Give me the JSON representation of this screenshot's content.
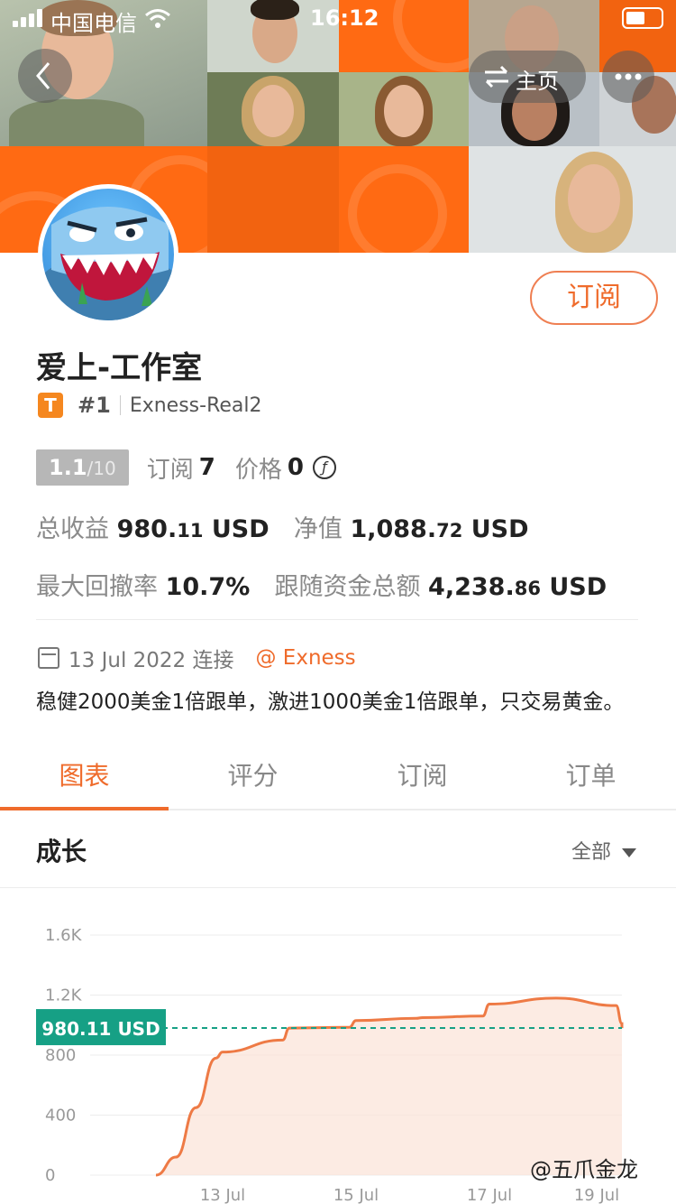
{
  "status_bar": {
    "carrier": "中国电信",
    "time": "16:12"
  },
  "nav": {
    "home_label": "主页"
  },
  "profile": {
    "subscribe_label": "订阅",
    "name": "爱上-工作室",
    "badge": "T",
    "rank": "#1",
    "account": "Exness-Real2",
    "score": "1.1",
    "score_max": "/10",
    "subs_label": "订阅",
    "subs_value": "7",
    "price_label": "价格",
    "price_value": "0",
    "coin_glyph": "ƒ",
    "total_profit_label": "总收益",
    "total_profit_int": "980.",
    "total_profit_dec": "11",
    "total_profit_unit": "USD",
    "equity_label": "净值",
    "equity_int": "1,088.",
    "equity_dec": "72",
    "equity_unit": "USD",
    "drawdown_label": "最大回撤率",
    "drawdown_value": "10.7%",
    "follow_label": "跟随资金总额",
    "follow_int": "4,238.",
    "follow_dec": "86",
    "follow_unit": "USD",
    "date": "13 Jul 2022 连接",
    "broker": "@ Exness",
    "description": "稳健2000美金1倍跟单，激进1000美金1倍跟单，只交易黄金。"
  },
  "tabs": [
    "图表",
    "评分",
    "订阅",
    "订单"
  ],
  "section": {
    "title": "成长",
    "filter": "全部"
  },
  "watermark": "@五爪金龙",
  "colors": {
    "accent": "#ef6b2b",
    "banner": "#ff6a13",
    "current_tag": "#16a085",
    "line": "#ee7a45"
  },
  "chart_data": {
    "type": "area",
    "y_ticks": [
      "1.6K",
      "1.2K",
      "800",
      "400",
      "0"
    ],
    "y_tick_values": [
      1600,
      1200,
      800,
      400,
      0
    ],
    "x_ticks": [
      "13 Jul",
      "15 Jul",
      "17 Jul",
      "19 Jul"
    ],
    "ylim": [
      0,
      1600
    ],
    "current_label": "980.11 USD",
    "current_value": 980.11,
    "series": [
      {
        "points": [
          [
            "12 Jul",
            0
          ],
          [
            "12 Jul",
            120
          ],
          [
            "12 Jul",
            450
          ],
          [
            "12 Jul",
            780
          ],
          [
            "13 Jul",
            820
          ],
          [
            "13 Jul",
            900
          ],
          [
            "14 Jul",
            980
          ],
          [
            "14 Jul",
            985
          ],
          [
            "15 Jul",
            1030
          ],
          [
            "15 Jul",
            1045
          ],
          [
            "16 Jul",
            1050
          ],
          [
            "16 Jul",
            1060
          ],
          [
            "17 Jul",
            1140
          ],
          [
            "18 Jul",
            1180
          ],
          [
            "18 Jul",
            1130
          ],
          [
            "19 Jul",
            1010
          ],
          [
            "19 Jul",
            980
          ]
        ]
      }
    ]
  }
}
